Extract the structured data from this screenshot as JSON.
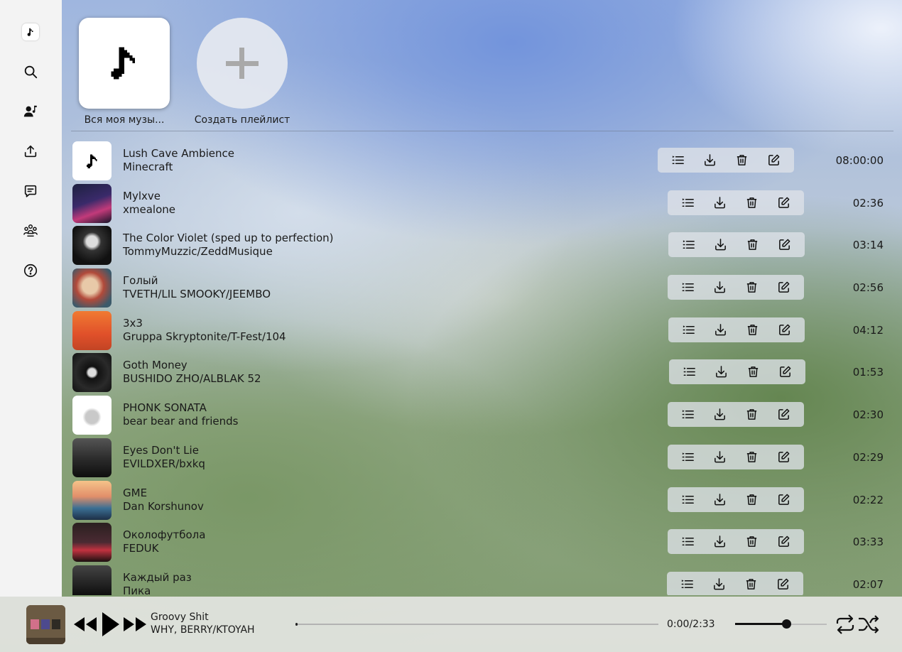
{
  "sidebar": {
    "items": [
      {
        "name": "logo",
        "icon": "music-note-icon"
      },
      {
        "name": "search",
        "icon": "search-icon"
      },
      {
        "name": "my-music",
        "icon": "user-music-icon"
      },
      {
        "name": "upload",
        "icon": "upload-icon"
      },
      {
        "name": "messages",
        "icon": "message-icon"
      },
      {
        "name": "community",
        "icon": "group-icon"
      },
      {
        "name": "help",
        "icon": "help-icon"
      }
    ]
  },
  "playlists": [
    {
      "label": "Вся моя музы...",
      "icon": "music-note-icon"
    },
    {
      "label": "Создать плейлист",
      "icon": "plus-icon"
    }
  ],
  "tracks": [
    {
      "title": "Lush Cave Ambience",
      "artist": "Minecraft",
      "duration": "08:00:00"
    },
    {
      "title": "Mylxve",
      "artist": "xmealone",
      "duration": "02:36"
    },
    {
      "title": "The Color Violet (sped up to perfection)",
      "artist": "TommyMuzzic/ZeddMusique",
      "duration": "03:14"
    },
    {
      "title": "Голый",
      "artist": "TVETH/LIL SMOOKY/JEEMBO",
      "duration": "02:56"
    },
    {
      "title": "3x3",
      "artist": "Gruppa Skryptonite/T-Fest/104",
      "duration": "04:12"
    },
    {
      "title": "Goth Money",
      "artist": "BUSHIDO ZHO/ALBLAK 52",
      "duration": "01:53"
    },
    {
      "title": "PHONK SONATA",
      "artist": "bear bear and friends",
      "duration": "02:30"
    },
    {
      "title": "Eyes Don't Lie",
      "artist": "EVILDXER/bxkq",
      "duration": "02:29"
    },
    {
      "title": "GME",
      "artist": "Dan Korshunov",
      "duration": "02:22"
    },
    {
      "title": "Околофутбола",
      "artist": "FEDUK",
      "duration": "03:33"
    },
    {
      "title": "Каждый раз",
      "artist": "Пика",
      "duration": "02:07"
    }
  ],
  "track_actions": [
    "queue-icon",
    "download-icon",
    "trash-icon",
    "edit-icon"
  ],
  "player": {
    "title": "Groovy Shit",
    "artist": "WHY, BERRY/KTOYAH",
    "time": "0:00/2:33",
    "progress": 0.0,
    "volume": 0.56,
    "controls": [
      "previous-icon",
      "play-icon",
      "next-icon",
      "repeat-icon",
      "shuffle-icon"
    ]
  }
}
